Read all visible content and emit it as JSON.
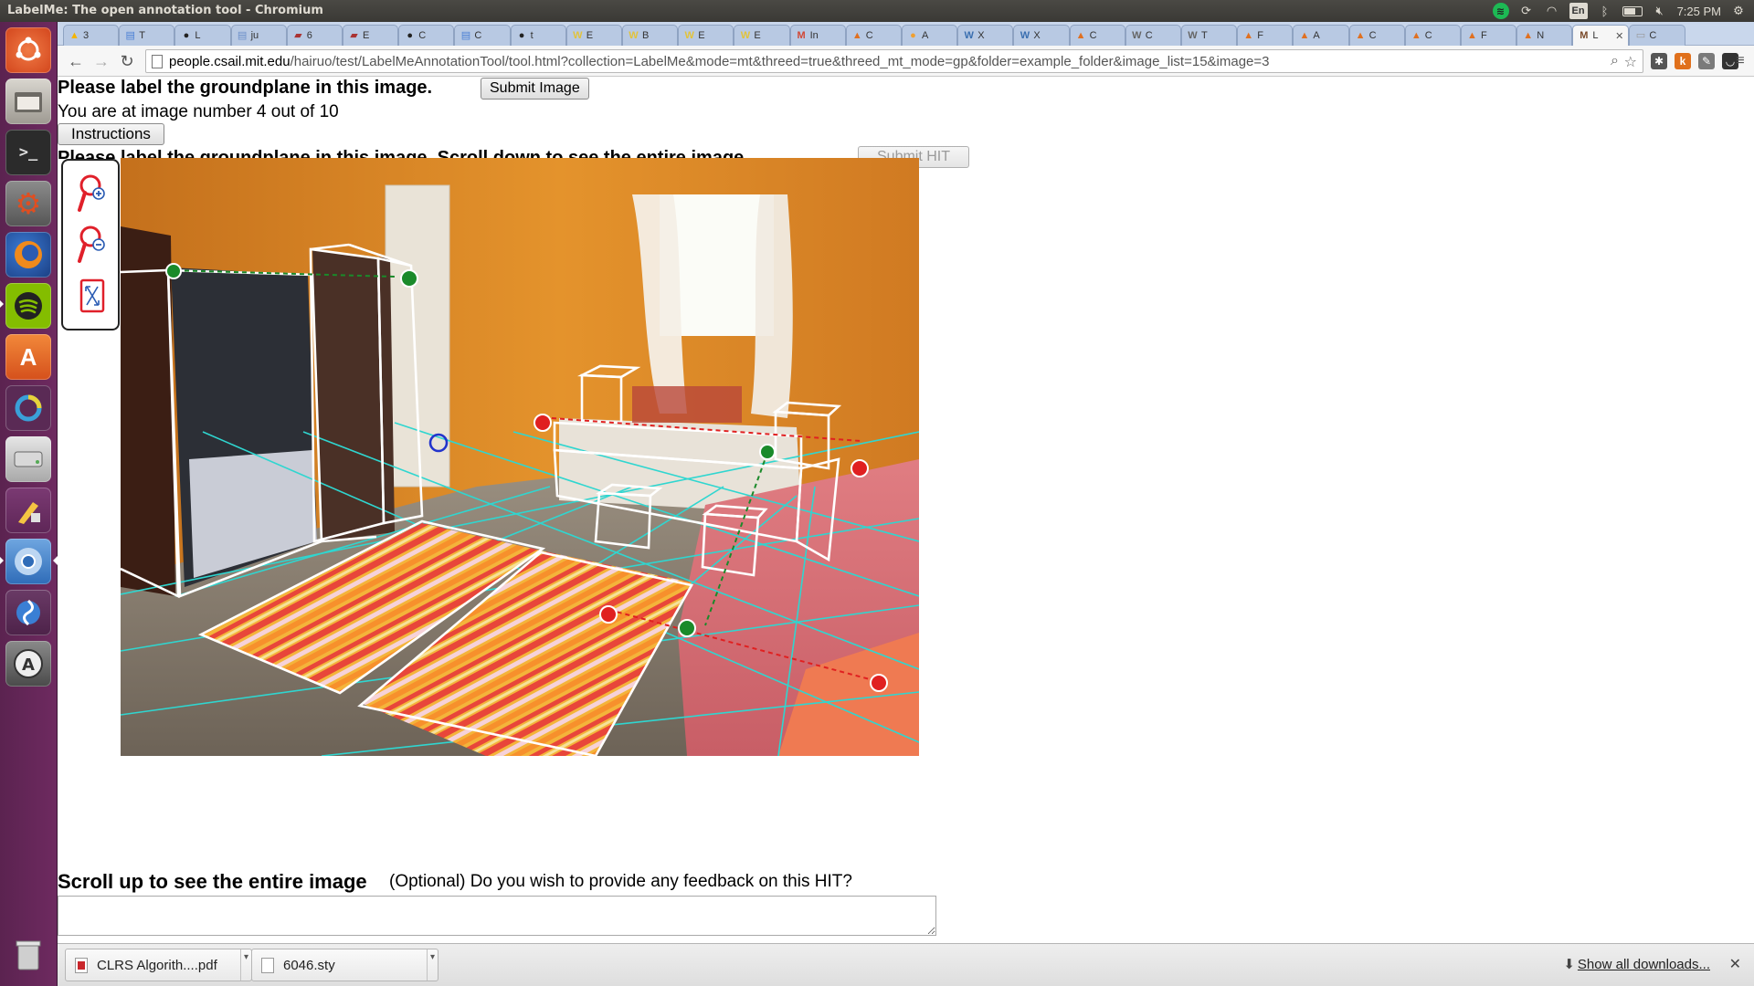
{
  "window": {
    "title": "LabelMe: The open annotation tool - Chromium"
  },
  "indicators": {
    "keyboard": "En",
    "time": "7:25 PM"
  },
  "launcher": {
    "items": [
      "ubuntu-dash",
      "files",
      "terminal",
      "system-settings",
      "firefox",
      "spotify",
      "software-center",
      "unity-tweak",
      "disks",
      "libreoffice-draw",
      "chromium",
      "shotwell",
      "software-updater",
      "trash"
    ]
  },
  "tabs": [
    {
      "label": "3",
      "favicon": "drive-icon",
      "color": "#f4b400"
    },
    {
      "label": "T",
      "favicon": "docs-icon",
      "color": "#4a7fd4"
    },
    {
      "label": "L",
      "favicon": "github-icon",
      "color": "#222222"
    },
    {
      "label": "ju",
      "favicon": "doc-icon",
      "color": "#6b8fc9"
    },
    {
      "label": "6",
      "favicon": "bookmark-icon",
      "color": "#a33"
    },
    {
      "label": "E",
      "favicon": "bookmark-icon",
      "color": "#a33"
    },
    {
      "label": "C",
      "favicon": "circle-icon",
      "color": "#222222"
    },
    {
      "label": "C",
      "favicon": "docs-icon",
      "color": "#4a7fd4"
    },
    {
      "label": "t",
      "favicon": "github-icon",
      "color": "#222222"
    },
    {
      "label": "E",
      "favicon": "wiki-icon",
      "color": "#e2c33b"
    },
    {
      "label": "B",
      "favicon": "wiki-icon",
      "color": "#e2c33b"
    },
    {
      "label": "E",
      "favicon": "wiki-icon",
      "color": "#e2c33b"
    },
    {
      "label": "E",
      "favicon": "wiki-icon",
      "color": "#e2c33b"
    },
    {
      "label": "In",
      "favicon": "gmail-icon",
      "color": "#d14836"
    },
    {
      "label": "C",
      "favicon": "matlab-icon",
      "color": "#e07020"
    },
    {
      "label": "A",
      "favicon": "circle-icon",
      "color": "#f0a030"
    },
    {
      "label": "X",
      "favicon": "w3-icon",
      "color": "#3a6fb0"
    },
    {
      "label": "X",
      "favicon": "w3-icon",
      "color": "#3a6fb0"
    },
    {
      "label": "C",
      "favicon": "matlab-icon",
      "color": "#e07020"
    },
    {
      "label": "C",
      "favicon": "wikipedia-icon",
      "color": "#666666"
    },
    {
      "label": "T",
      "favicon": "wikipedia-icon",
      "color": "#666666"
    },
    {
      "label": "F",
      "favicon": "matlab-icon",
      "color": "#e07020"
    },
    {
      "label": "A",
      "favicon": "matlab-icon",
      "color": "#e07020"
    },
    {
      "label": "C",
      "favicon": "matlab-icon",
      "color": "#e07020"
    },
    {
      "label": "C",
      "favicon": "matlab-icon",
      "color": "#e07020"
    },
    {
      "label": "F",
      "favicon": "matlab-icon",
      "color": "#e07020"
    },
    {
      "label": "N",
      "favicon": "matlab-icon",
      "color": "#e07020"
    },
    {
      "label": "L",
      "favicon": "labelme-icon",
      "color": "#7a4a2a",
      "active": true,
      "close": "✕"
    },
    {
      "label": "C",
      "favicon": "page-icon",
      "color": "#999999"
    }
  ],
  "address_bar": {
    "host": "people.csail.mit.edu",
    "path": "/hairuo/test/LabelMeAnnotationTool/tool.html?collection=LabelMe&mode=mt&threed=true&threed_mt_mode=gp&folder=example_folder&image_list=15&image=3"
  },
  "page": {
    "title": "Please label the groundplane in this image.",
    "submit_image": "Submit Image",
    "counter": "You are at image number 4 out of 10",
    "instructions": "Instructions",
    "title_scroll": "Please label the groundplane in this image. Scroll down to see the entire image.",
    "submit_hit": "Submit HIT",
    "tools": [
      "zoom-in-icon",
      "zoom-out-icon",
      "fit-to-screen-icon"
    ],
    "scroll_up": "Scroll up to see the entire image",
    "feedback_question": "(Optional) Do you wish to provide any feedback on this HIT?",
    "feedback_value": ""
  },
  "colors": {
    "wall": "#e0902a",
    "grid": "#2fd6d0",
    "box_outline": "#ffffff",
    "control_point_green": "#1a8a2a",
    "control_point_red": "#e02020",
    "control_point_blue": "#2233cc"
  },
  "downloads": {
    "items": [
      {
        "name": "CLRS Algorith....pdf",
        "type": "pdf"
      },
      {
        "name": "6046.sty",
        "type": "file"
      }
    ],
    "show_all": "Show all downloads...",
    "close": "✕"
  }
}
